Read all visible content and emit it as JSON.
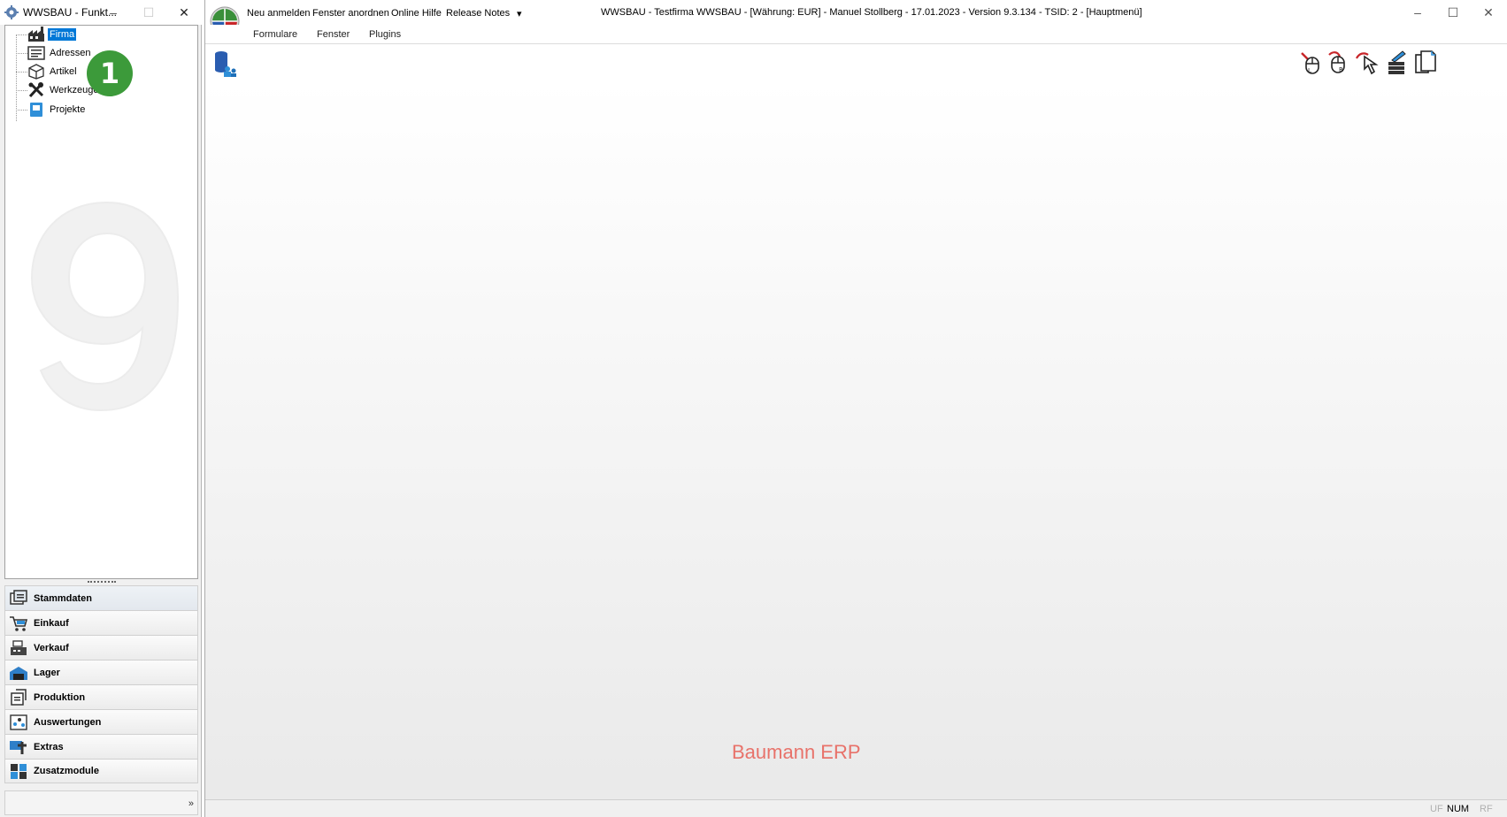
{
  "left_window": {
    "title": "WWSBAU - Funkt...",
    "caption_buttons": {
      "minimize": "–",
      "maximize": "☐",
      "close": "✕"
    }
  },
  "tree": {
    "items": [
      {
        "label": "Firma",
        "icon": "factory-icon",
        "selected": true
      },
      {
        "label": "Adressen",
        "icon": "address-card-icon",
        "selected": false
      },
      {
        "label": "Artikel",
        "icon": "box-icon",
        "selected": false
      },
      {
        "label": "Werkzeuge",
        "icon": "tools-icon",
        "selected": false
      },
      {
        "label": "Projekte",
        "icon": "project-icon",
        "selected": false
      }
    ],
    "step_badge": "1"
  },
  "nav": {
    "items": [
      {
        "label": "Stammdaten",
        "icon": "master-data-icon"
      },
      {
        "label": "Einkauf",
        "icon": "cart-icon"
      },
      {
        "label": "Verkauf",
        "icon": "cash-register-icon"
      },
      {
        "label": "Lager",
        "icon": "warehouse-icon"
      },
      {
        "label": "Produktion",
        "icon": "production-icon"
      },
      {
        "label": "Auswertungen",
        "icon": "chart-icon"
      },
      {
        "label": "Extras",
        "icon": "extras-icon"
      },
      {
        "label": "Zusatzmodule",
        "icon": "modules-icon"
      }
    ],
    "footer_chevron": "»"
  },
  "main_window": {
    "commands": [
      "Neu anmelden",
      "Fenster anordnen",
      "Online Hilfe",
      "Release Notes"
    ],
    "overflow": "▾",
    "title": "WWSBAU - Testfirma WWSBAU - [Währung: EUR] - Manuel Stollberg - 17.01.2023 - Version 9.3.134 - TSID: 2  - [Hauptmenü]",
    "caption_buttons": {
      "minimize": "–",
      "maximize": "☐",
      "close": "✕"
    },
    "ribbon_tabs": [
      "Formulare",
      "Fenster",
      "Plugins"
    ],
    "brand": "Baumann ERP",
    "status": {
      "uf": "UF",
      "num": "NUM",
      "rf": "RF"
    }
  },
  "colors": {
    "selection": "#0078d7",
    "badge": "#3c9a3a",
    "brand": "#e8726a"
  }
}
